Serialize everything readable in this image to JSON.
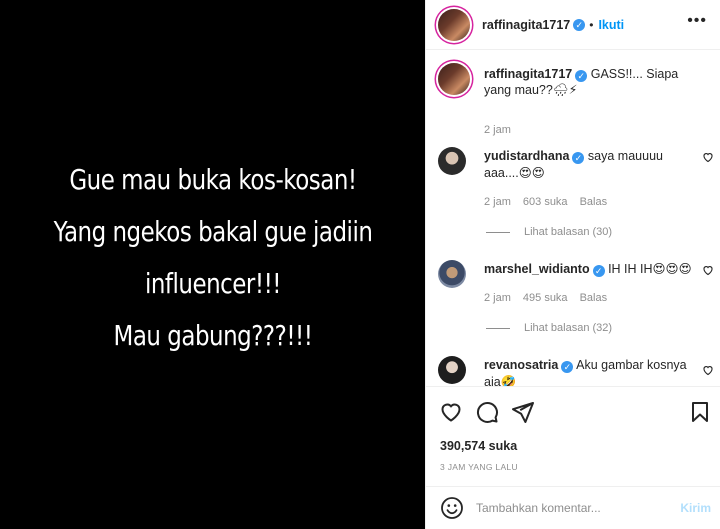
{
  "post": {
    "image_text_lines": [
      "Gue mau buka kos-kosan!",
      "Yang ngekos bakal gue jadiin",
      "influencer!!!",
      "Mau gabung???!!!"
    ]
  },
  "header": {
    "username": "raffinagita1717",
    "separator": "•",
    "follow_label": "Ikuti",
    "more_label": "•••"
  },
  "caption": {
    "username": "raffinagita1717",
    "text": "GASS!!... Siapa yang mau??🌧⚡",
    "time": "2 jam"
  },
  "comments": [
    {
      "username": "yudistardhana",
      "text": "saya mauuuu aaa....😍😍",
      "time": "2 jam",
      "likes": "603 suka",
      "reply_label": "Balas",
      "view_replies": "Lihat balasan (30)"
    },
    {
      "username": "marshel_widianto",
      "text": "IH IH IH😍😍😍",
      "time": "2 jam",
      "likes": "495 suka",
      "reply_label": "Balas",
      "view_replies": "Lihat balasan (32)"
    },
    {
      "username": "revanosatria",
      "text": "Aku gambar kosnya aja🤣"
    }
  ],
  "stats": {
    "likes": "390,574 suka",
    "time": "3 JAM YANG LALU"
  },
  "composer": {
    "placeholder": "Tambahkan komentar...",
    "post_label": "Kirim"
  },
  "icons": {
    "verified": "verified-badge-icon",
    "like": "heart-icon",
    "comment": "comment-icon",
    "share": "paper-plane-icon",
    "save": "bookmark-icon",
    "emoji": "smiley-icon"
  },
  "colors": {
    "accent": "#0095f6",
    "verified": "#3897f0",
    "muted": "#8e8e8e",
    "post_disabled": "#b2dffc"
  }
}
